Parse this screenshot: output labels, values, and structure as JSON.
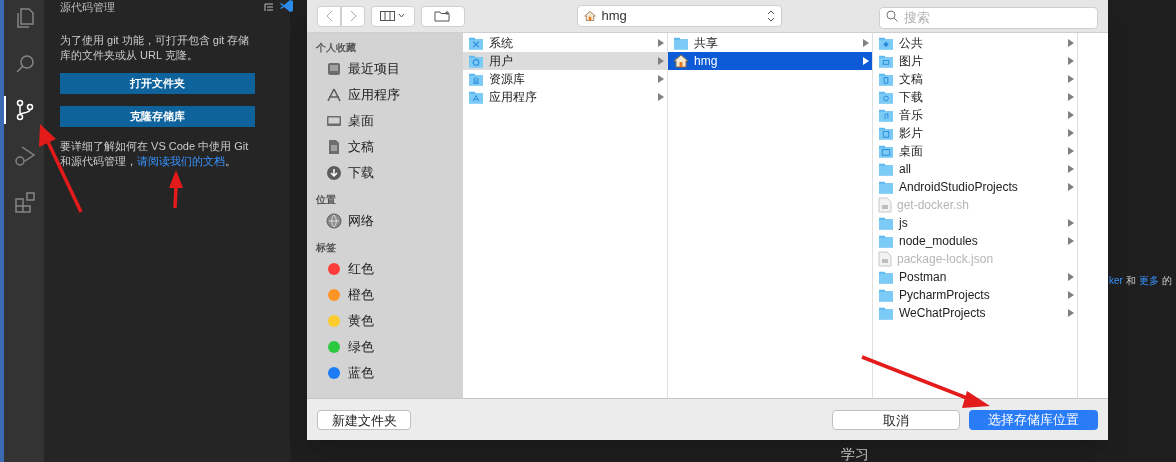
{
  "activity_bar": {
    "items": [
      {
        "kind": "files",
        "selected": false
      },
      {
        "kind": "search",
        "selected": false
      },
      {
        "kind": "source-control",
        "selected": true
      },
      {
        "kind": "run-debug",
        "selected": false
      },
      {
        "kind": "extensions",
        "selected": false
      }
    ]
  },
  "sidebar": {
    "title": "源代码管理",
    "intro": "为了使用 git 功能，可打开包含 git 存储库的文件夹或从 URL 克隆。",
    "buttons": [
      "打开文件夹",
      "克隆存储库"
    ],
    "help_text": "要详细了解如何在 VS Code 中使用 Git 和源代码管理，",
    "help_link": "请阅读我们的文档",
    "help_end": "。"
  },
  "editor": {
    "line": [
      {
        "text": "ker",
        "link": true
      },
      {
        "text": "和",
        "link": false
      },
      {
        "text": "更多",
        "link": true
      },
      {
        "text": "的",
        "link": false
      }
    ],
    "bottom_text": "学习"
  },
  "dialog": {
    "location": "hmg",
    "search": {
      "placeholder": "搜索"
    },
    "sidebar": [
      {
        "heading": "个人收藏",
        "items": [
          {
            "label": "最近项目",
            "kind": "recents"
          },
          {
            "label": "应用程序",
            "kind": "apps"
          },
          {
            "label": "桌面",
            "kind": "desktop"
          },
          {
            "label": "文稿",
            "kind": "documents"
          },
          {
            "label": "下载",
            "kind": "downloads"
          }
        ]
      },
      {
        "heading": "位置",
        "items": [
          {
            "label": "网络",
            "kind": "network"
          }
        ]
      },
      {
        "heading": "标签",
        "items": [
          {
            "label": "红色",
            "kind": "tag",
            "color": "#fc3d39"
          },
          {
            "label": "橙色",
            "kind": "tag",
            "color": "#fd9426"
          },
          {
            "label": "黄色",
            "kind": "tag",
            "color": "#fecb2e"
          },
          {
            "label": "绿色",
            "kind": "tag",
            "color": "#2ac940"
          },
          {
            "label": "蓝色",
            "kind": "tag",
            "color": "#1d7bf6"
          }
        ]
      }
    ],
    "columns": [
      {
        "items": [
          {
            "label": "系统",
            "kind": "system",
            "selected": false,
            "disabled": false
          },
          {
            "label": "用户",
            "kind": "users",
            "selected": true,
            "disabled": false
          },
          {
            "label": "资源库",
            "kind": "library",
            "selected": false,
            "disabled": false
          },
          {
            "label": "应用程序",
            "kind": "apps",
            "selected": false,
            "disabled": false
          }
        ]
      },
      {
        "items": [
          {
            "label": "共享",
            "kind": "folder",
            "selected": false,
            "disabled": false
          },
          {
            "label": "hmg",
            "kind": "home",
            "selected": true,
            "disabled": false
          }
        ]
      },
      {
        "items": [
          {
            "label": "公共",
            "kind": "public",
            "selected": false,
            "disabled": false
          },
          {
            "label": "图片",
            "kind": "pictures",
            "selected": false,
            "disabled": false
          },
          {
            "label": "文稿",
            "kind": "documents",
            "selected": false,
            "disabled": false
          },
          {
            "label": "下载",
            "kind": "downloads",
            "selected": false,
            "disabled": false
          },
          {
            "label": "音乐",
            "kind": "music",
            "selected": false,
            "disabled": false
          },
          {
            "label": "影片",
            "kind": "movies",
            "selected": false,
            "disabled": false
          },
          {
            "label": "桌面",
            "kind": "desktop",
            "selected": false,
            "disabled": false
          },
          {
            "label": "all",
            "kind": "folder",
            "selected": false,
            "disabled": false
          },
          {
            "label": "AndroidStudioProjects",
            "kind": "folder",
            "selected": false,
            "disabled": false
          },
          {
            "label": "get-docker.sh",
            "kind": "file",
            "selected": false,
            "disabled": true
          },
          {
            "label": "js",
            "kind": "folder",
            "selected": false,
            "disabled": false
          },
          {
            "label": "node_modules",
            "kind": "folder",
            "selected": false,
            "disabled": false
          },
          {
            "label": "package-lock.json",
            "kind": "file",
            "selected": false,
            "disabled": true
          },
          {
            "label": "Postman",
            "kind": "folder",
            "selected": false,
            "disabled": false
          },
          {
            "label": "PycharmProjects",
            "kind": "folder",
            "selected": false,
            "disabled": false
          },
          {
            "label": "WeChatProjects",
            "kind": "folder",
            "selected": false,
            "disabled": false
          }
        ]
      }
    ],
    "buttons": {
      "new_folder": "新建文件夹",
      "cancel": "取消",
      "confirm": "选择存储库位置"
    }
  }
}
